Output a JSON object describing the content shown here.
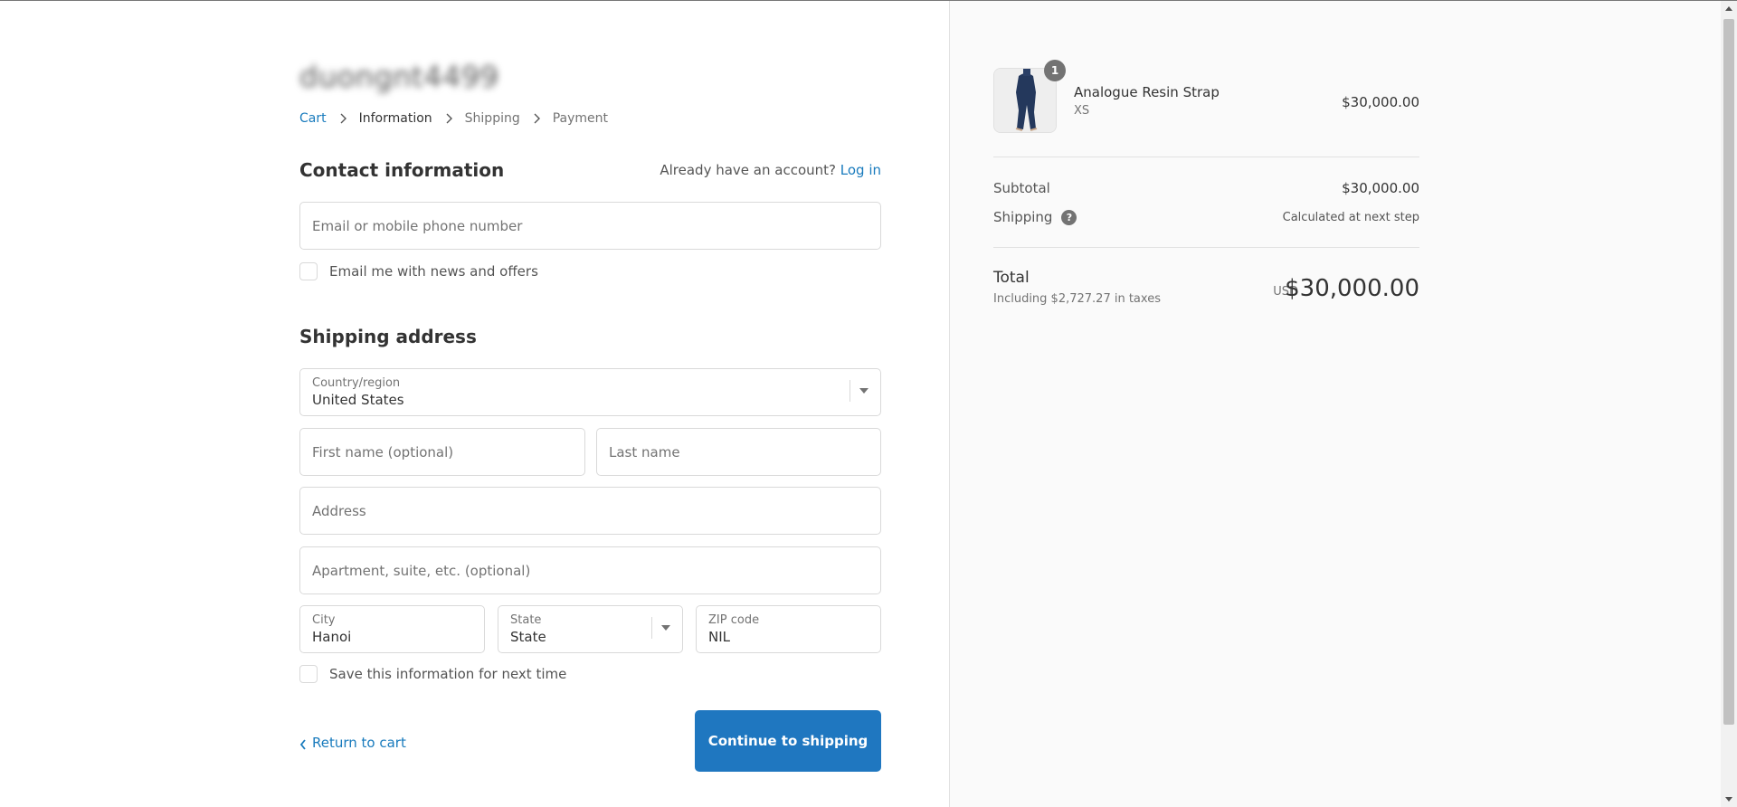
{
  "shop": {
    "name": "duongnt4499"
  },
  "breadcrumb": [
    {
      "label": "Cart",
      "state": "link"
    },
    {
      "label": "Information",
      "state": "current"
    },
    {
      "label": "Shipping",
      "state": "upcoming"
    },
    {
      "label": "Payment",
      "state": "upcoming"
    }
  ],
  "contact": {
    "title": "Contact information",
    "account_prompt": "Already have an account?",
    "login_label": "Log in",
    "email_placeholder": "Email or mobile phone number",
    "newsletter_label": "Email me with news and offers"
  },
  "shipping_address": {
    "title": "Shipping address",
    "country_label": "Country/region",
    "country_value": "United States",
    "first_name_placeholder": "First name (optional)",
    "last_name_placeholder": "Last name",
    "address_placeholder": "Address",
    "apartment_placeholder": "Apartment, suite, etc. (optional)",
    "city_label": "City",
    "city_value": "Hanoi",
    "state_label": "State",
    "state_value": "State",
    "zip_label": "ZIP code",
    "zip_value": "NIL",
    "save_label": "Save this information for next time"
  },
  "actions": {
    "return_label": "Return to cart",
    "continue_label": "Continue to shipping"
  },
  "order": {
    "item": {
      "quantity": "1",
      "name": "Analogue Resin Strap",
      "variant": "XS",
      "price": "$30,000.00"
    },
    "subtotal_label": "Subtotal",
    "subtotal_value": "$30,000.00",
    "shipping_label": "Shipping",
    "shipping_value": "Calculated at next step",
    "total_label": "Total",
    "tax_note": "Including $2,727.27 in taxes",
    "currency": "USD",
    "total_value": "$30,000.00"
  },
  "colors": {
    "accent": "#197bbd",
    "button": "#1f77c0",
    "sidebar_bg": "#fafafa"
  },
  "icons": {
    "breadcrumb_separator": "chevron-right-icon",
    "shipping_help": "question-icon",
    "return": "chevron-left-icon",
    "select": "caret-down-icon"
  }
}
